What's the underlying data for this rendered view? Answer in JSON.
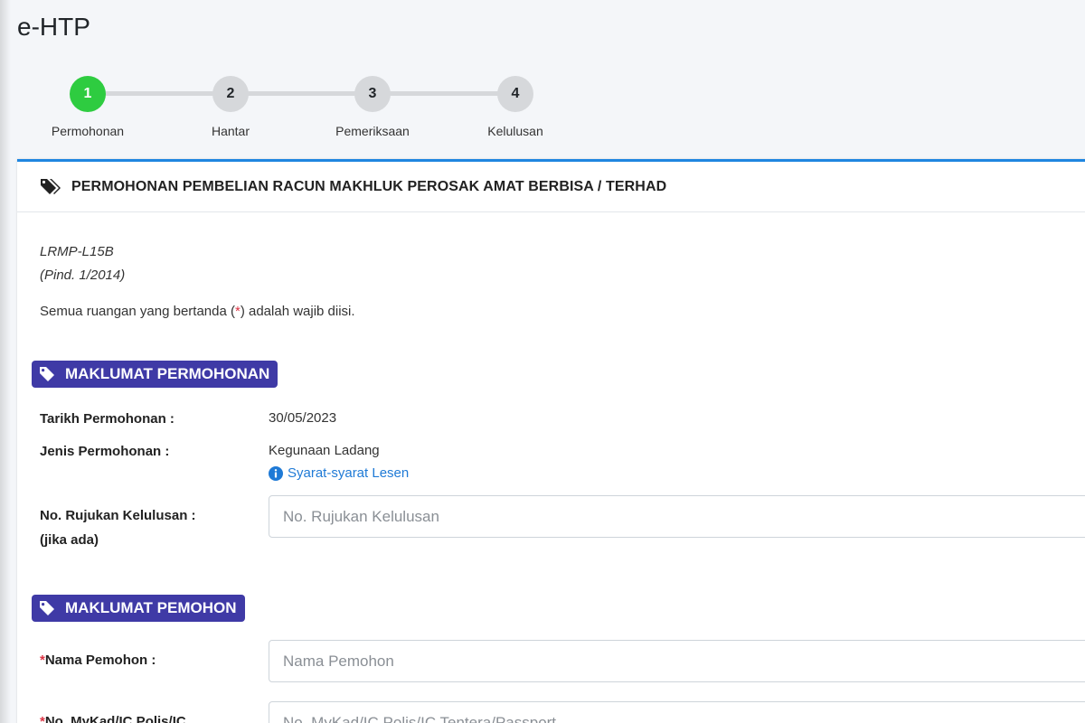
{
  "app": {
    "title": "e-HTP"
  },
  "stepper": {
    "steps": [
      {
        "number": "1",
        "label": "Permohonan",
        "active": true
      },
      {
        "number": "2",
        "label": "Hantar",
        "active": false
      },
      {
        "number": "3",
        "label": "Pemeriksaan",
        "active": false
      },
      {
        "number": "4",
        "label": "Kelulusan",
        "active": false
      }
    ]
  },
  "card": {
    "title": "PERMOHONAN PEMBELIAN RACUN MAKHLUK PEROSAK AMAT BERBISA / TERHAD",
    "form_code": "LRMP-L15B",
    "form_revision": "(Pind. 1/2014)",
    "note_before": "Semua ruangan yang bertanda (",
    "note_star": "*",
    "note_after": ") adalah wajib diisi."
  },
  "section_permohonan": {
    "title": "MAKLUMAT PERMOHONAN",
    "tarikh_label": "Tarikh Permohonan :",
    "tarikh_value": "30/05/2023",
    "jenis_label": "Jenis Permohonan :",
    "jenis_value": "Kegunaan Ladang",
    "syarat_link": "Syarat-syarat Lesen",
    "rujukan_label": "No. Rujukan Kelulusan :",
    "rujukan_sublabel": "(jika ada)",
    "rujukan_placeholder": "No. Rujukan Kelulusan",
    "rujukan_value": ""
  },
  "section_pemohon": {
    "title": "MAKLUMAT PEMOHON",
    "required_mark": "*",
    "nama_label": "Nama Pemohon :",
    "nama_placeholder": "Nama Pemohon",
    "nama_value": "",
    "mykad_label": "No. MyKad/IC Polis/IC",
    "mykad_placeholder": "No. MyKad/IC Polis/IC Tentera/Passport",
    "mykad_value": ""
  },
  "colors": {
    "step_active": "#2ecc40",
    "step_inactive": "#d6d8db",
    "card_accent": "#1f86e0",
    "section_badge": "#3f3aa6",
    "link": "#1f7ad6",
    "required": "#dc3545"
  },
  "icons": {
    "header": "tags-icon",
    "section": "tag-icon",
    "info": "info-circle-icon"
  }
}
